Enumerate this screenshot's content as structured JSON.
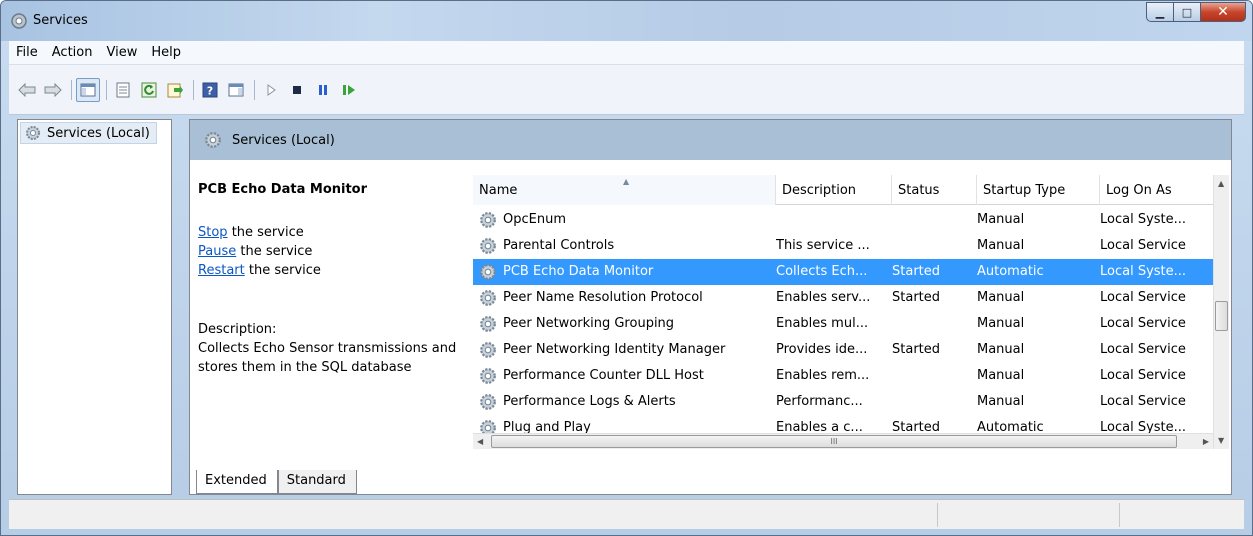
{
  "window": {
    "title": "Services",
    "accent": "#3399ff"
  },
  "menu": [
    "File",
    "Action",
    "View",
    "Help"
  ],
  "toolbar": {
    "icons": [
      "back-arrow-icon",
      "forward-arrow-icon",
      "show-hide-console-tree-icon",
      "properties-icon",
      "refresh-icon",
      "export-list-icon",
      "help-icon",
      "show-hide-action-pane-icon",
      "start-service-icon",
      "stop-service-icon",
      "pause-service-icon",
      "resume-service-icon"
    ]
  },
  "tree": {
    "root": "Services (Local)"
  },
  "pane": {
    "header": "Services (Local)",
    "service_name": "PCB Echo Data Monitor",
    "actions": [
      {
        "link": "Stop",
        "rest": " the service"
      },
      {
        "link": "Pause",
        "rest": " the service"
      },
      {
        "link": "Restart",
        "rest": " the service"
      }
    ],
    "description_label": "Description:",
    "description": "Collects Echo Sensor transmissions and stores them in the SQL database"
  },
  "list": {
    "columns": [
      "Name",
      "Description",
      "Status",
      "Startup Type",
      "Log On As"
    ],
    "rows": [
      {
        "name": "OpcEnum",
        "description": "",
        "status": "",
        "startup": "Manual",
        "logon": "Local Syste..."
      },
      {
        "name": "Parental Controls",
        "description": "This service ...",
        "status": "",
        "startup": "Manual",
        "logon": "Local Service"
      },
      {
        "name": "PCB Echo Data Monitor",
        "description": "Collects Ech...",
        "status": "Started",
        "startup": "Automatic",
        "logon": "Local Syste...",
        "selected": true
      },
      {
        "name": "Peer Name Resolution Protocol",
        "description": "Enables serv...",
        "status": "Started",
        "startup": "Manual",
        "logon": "Local Service"
      },
      {
        "name": "Peer Networking Grouping",
        "description": "Enables mul...",
        "status": "",
        "startup": "Manual",
        "logon": "Local Service"
      },
      {
        "name": "Peer Networking Identity Manager",
        "description": "Provides ide...",
        "status": "Started",
        "startup": "Manual",
        "logon": "Local Service"
      },
      {
        "name": "Performance Counter DLL Host",
        "description": "Enables rem...",
        "status": "",
        "startup": "Manual",
        "logon": "Local Service"
      },
      {
        "name": "Performance Logs & Alerts",
        "description": "Performanc...",
        "status": "",
        "startup": "Manual",
        "logon": "Local Service"
      },
      {
        "name": "Plug and Play",
        "description": "Enables a c...",
        "status": "Started",
        "startup": "Automatic",
        "logon": "Local Syste..."
      }
    ],
    "hscroll_grip": "III"
  },
  "tabs": [
    "Extended",
    "Standard"
  ]
}
